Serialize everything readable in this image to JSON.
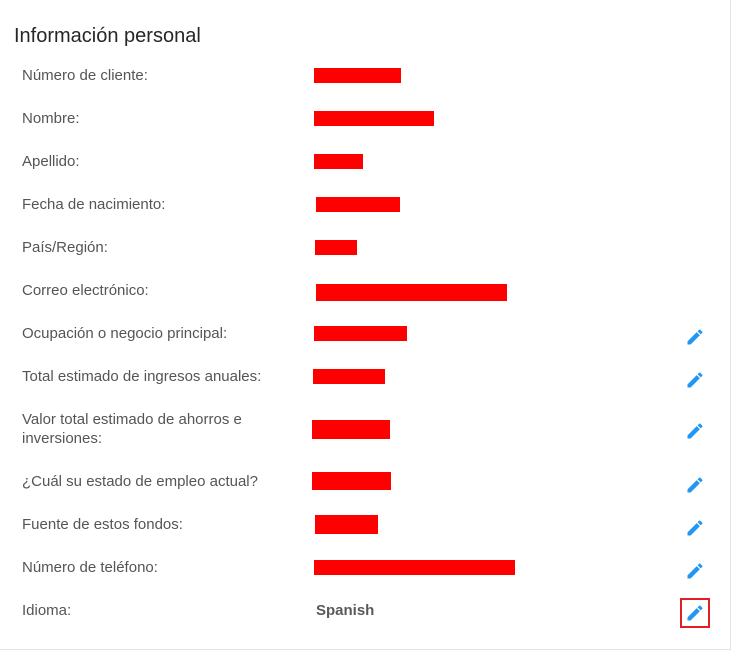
{
  "section": {
    "title": "Información personal"
  },
  "fields": [
    {
      "label": "Número de cliente:"
    },
    {
      "label": "Nombre:"
    },
    {
      "label": "Apellido:"
    },
    {
      "label": "Fecha de nacimiento:"
    },
    {
      "label": "País/Región:"
    },
    {
      "label": "Correo electrónico:"
    },
    {
      "label": "Ocupación o negocio principal:"
    },
    {
      "label": "Total estimado de ingresos anuales:"
    },
    {
      "label": "Valor total estimado de ahorros e inversiones:"
    },
    {
      "label": "¿Cuál su estado de empleo actual?"
    },
    {
      "label": "Fuente de estos fondos:"
    },
    {
      "label": "Número de teléfono:"
    },
    {
      "label": "Idioma:",
      "value": "Spanish"
    }
  ],
  "colors": {
    "edit_icon": "#2196f3",
    "redaction": "#ff0000",
    "highlight_border": "#e21f26"
  },
  "icons": {
    "edit": "pencil-icon"
  }
}
